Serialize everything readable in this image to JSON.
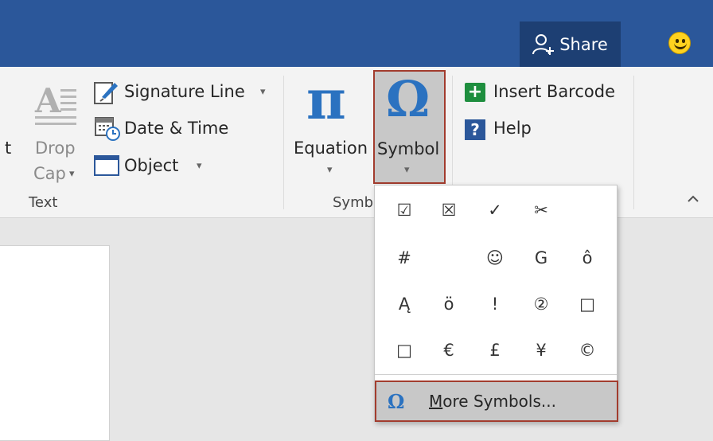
{
  "titlebar": {
    "share_label": "Share",
    "share_icon": "person-add-icon",
    "smiley_icon": "smiley-feedback-icon"
  },
  "ribbon": {
    "cut_text": "t",
    "drop_cap": {
      "line1": "Drop",
      "line2": "Cap",
      "arrow": "▾"
    },
    "signature_line": "Signature Line",
    "date_time": "Date & Time",
    "object": "Object",
    "text_group": "Text",
    "equation": {
      "label": "Equation",
      "icon": "π"
    },
    "symbol": {
      "label": "Symbol",
      "icon": "Ω"
    },
    "symbols_group": "Symb",
    "insert_barcode": "Insert Barcode",
    "help": "Help",
    "dropdown_arrow": "▾"
  },
  "symbol_menu": {
    "symbols": [
      "☑",
      "☒",
      "✓",
      "✂",
      "",
      "#",
      "",
      "☺",
      "G",
      "ô",
      "Ą",
      "ö",
      "!",
      "②",
      "□",
      "□",
      "€",
      "£",
      "¥",
      "©"
    ],
    "more_icon": "Ω",
    "more_label_underlined": "M",
    "more_label_rest": "ore Symbols..."
  }
}
